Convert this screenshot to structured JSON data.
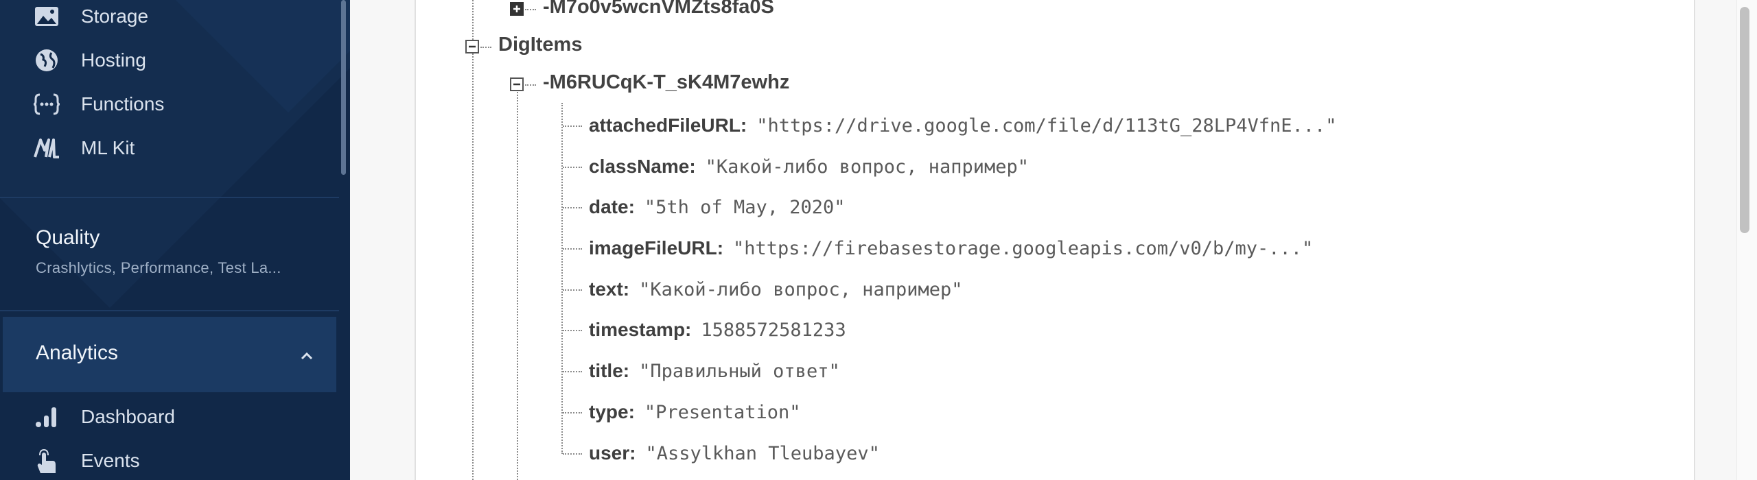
{
  "sidebar": {
    "items": [
      {
        "label": "Storage",
        "icon": "image-icon"
      },
      {
        "label": "Hosting",
        "icon": "globe-icon"
      },
      {
        "label": "Functions",
        "icon": "functions-icon"
      },
      {
        "label": "ML Kit",
        "icon": "ml-kit-icon"
      }
    ],
    "quality": {
      "title": "Quality",
      "subtitle": "Crashlytics, Performance, Test La..."
    },
    "analytics": {
      "title": "Analytics",
      "items": [
        {
          "label": "Dashboard",
          "icon": "bar-chart-icon"
        },
        {
          "label": "Events",
          "icon": "touch-icon"
        }
      ]
    }
  },
  "tree": {
    "prev_key": "-M7o0v5wcnVMZts8fa0S",
    "node": "DigItems",
    "child_key": "-M6RUCqK-T_sK4M7ewhz",
    "fields": [
      {
        "key": "attachedFileURL:",
        "value": "\"https://drive.google.com/file/d/113tG_28LP4VfnE...\""
      },
      {
        "key": "className:",
        "value": "\"Какой-либо вопрос, например\""
      },
      {
        "key": "date:",
        "value": "\"5th of May, 2020\""
      },
      {
        "key": "imageFileURL:",
        "value": "\"https://firebasestorage.googleapis.com/v0/b/my-...\""
      },
      {
        "key": "text:",
        "value": "\"Какой-либо вопрос, например\""
      },
      {
        "key": "timestamp:",
        "value": "1588572581233"
      },
      {
        "key": "title:",
        "value": "\"Правильный ответ\""
      },
      {
        "key": "type:",
        "value": "\"Presentation\""
      },
      {
        "key": "user:",
        "value": "\"Assylkhan Tleubayev\""
      }
    ]
  }
}
